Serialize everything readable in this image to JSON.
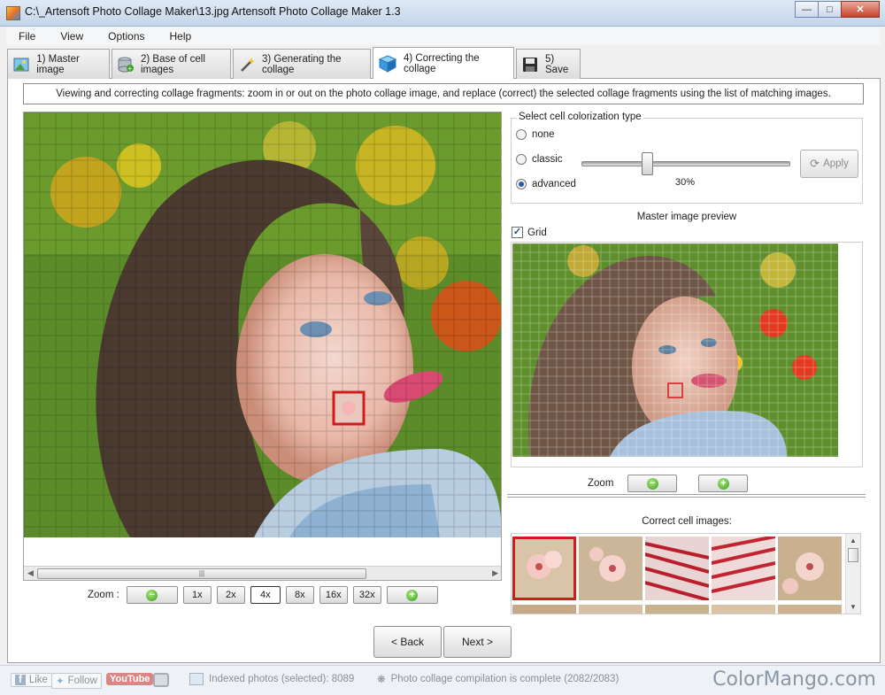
{
  "window": {
    "title": "C:\\_Artensoft Photo Collage Maker\\13.jpg Artensoft Photo Collage Maker 1.3",
    "controls": [
      "minimize",
      "maximize",
      "close"
    ]
  },
  "menu": [
    "File",
    "View",
    "Options",
    "Help"
  ],
  "tabs": [
    {
      "label": "1) Master image",
      "icon": "picture-icon"
    },
    {
      "label": "2) Base of cell images",
      "icon": "database-add-icon"
    },
    {
      "label": "3) Generating the collage",
      "icon": "magic-wand-icon"
    },
    {
      "label": "4) Correcting the collage",
      "icon": "cube-icon",
      "active": true
    },
    {
      "label": "5) Save",
      "icon": "floppy-disk-icon"
    }
  ],
  "info_text": "Viewing and correcting collage fragments: zoom in or out on the photo collage image, and replace (correct) the selected collage fragments using the list of matching images.",
  "collage_zoom": {
    "label": "Zoom   :",
    "options": [
      "1x",
      "2x",
      "4x",
      "8x",
      "16x",
      "32x"
    ],
    "selected": "4x"
  },
  "colorization": {
    "group_label": "Select cell colorization type",
    "options": [
      "none",
      "classic",
      "advanced"
    ],
    "selected": "advanced",
    "slider_percent": 30,
    "slider_label": "30%",
    "apply_label": "Apply"
  },
  "preview": {
    "title": "Master image preview",
    "grid_label": "Grid",
    "grid_checked": true,
    "zoom_label": "Zoom"
  },
  "correct": {
    "title": "Correct cell images:"
  },
  "nav": {
    "back": "< Back",
    "next": "Next >"
  },
  "status": {
    "like": "Like",
    "follow": "Follow",
    "youtube": "YouTube",
    "indexed": "Indexed photos (selected): 8089",
    "compilation": "Photo collage compilation is complete (2082/2083)",
    "brand": "ColorMango.com"
  },
  "colors": {
    "selection_red": "#d11c1c",
    "accent_green": "#3a9a1e",
    "titlebar": "#c4d5ea"
  }
}
